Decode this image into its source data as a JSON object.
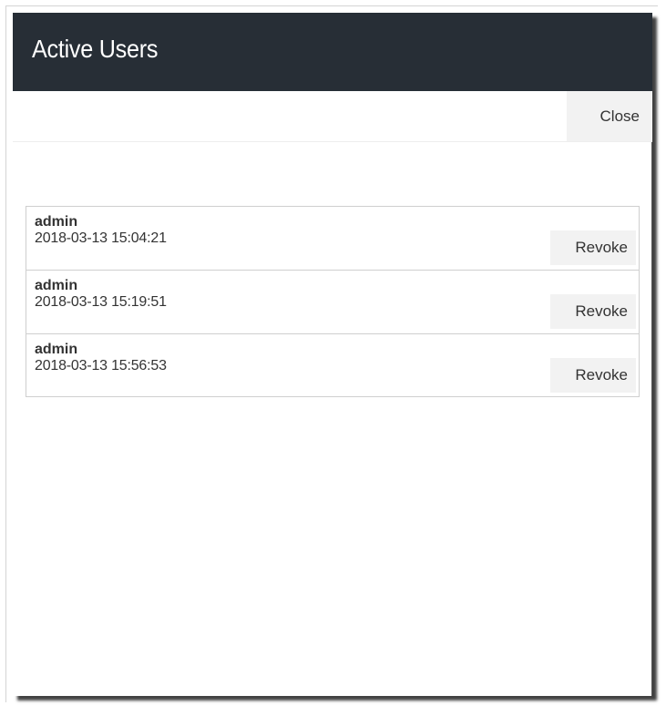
{
  "dialog": {
    "title": "Active Users",
    "close_label": "Close"
  },
  "users": [
    {
      "name": "admin",
      "time": "2018-03-13 15:04:21",
      "action": "Revoke"
    },
    {
      "name": "admin",
      "time": "2018-03-13 15:19:51",
      "action": "Revoke"
    },
    {
      "name": "admin",
      "time": "2018-03-13 15:56:53",
      "action": "Revoke"
    }
  ]
}
